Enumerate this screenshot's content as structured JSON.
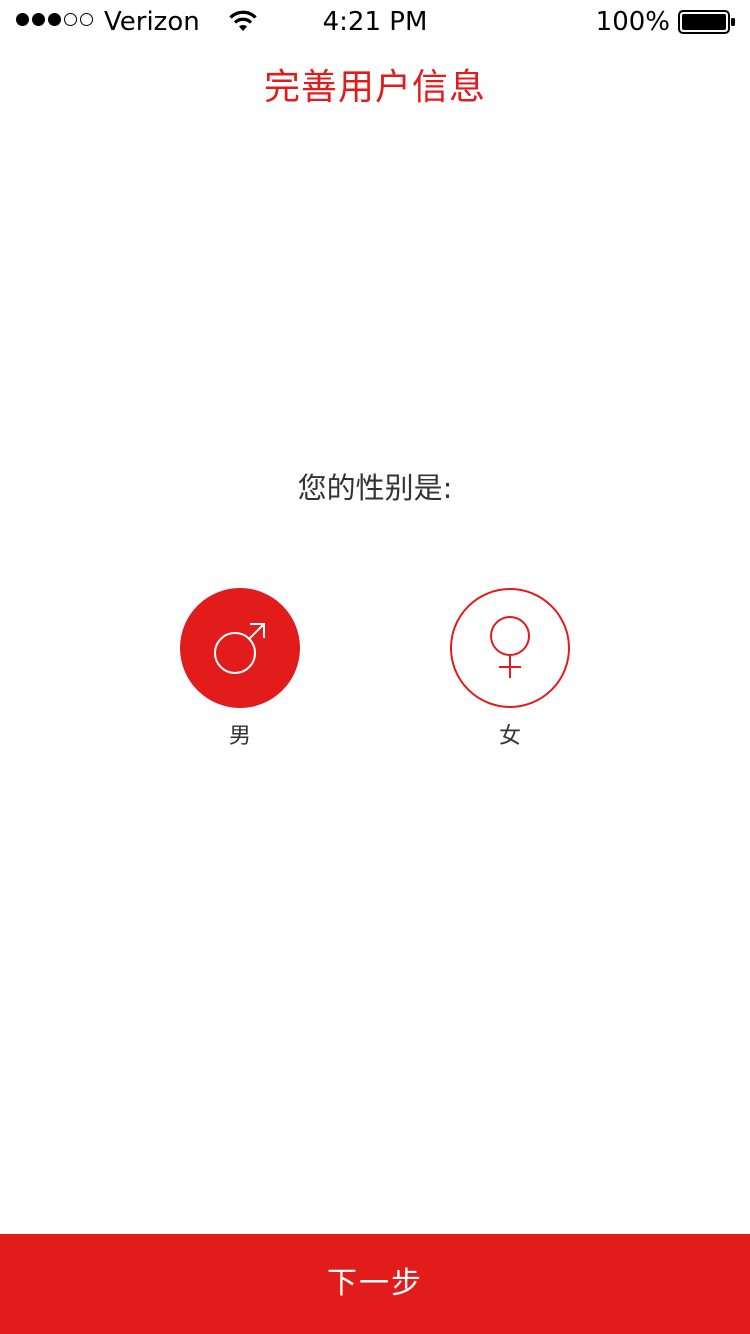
{
  "status_bar": {
    "carrier": "Verizon",
    "time": "4:21 PM",
    "battery": "100%",
    "signal_bars_filled": 3,
    "signal_bars_total": 5
  },
  "header": {
    "title": "完善用户信息"
  },
  "main": {
    "question": "您的性别是:",
    "options": [
      {
        "label": "男",
        "icon": "male-symbol-icon",
        "selected": true
      },
      {
        "label": "女",
        "icon": "female-symbol-icon",
        "selected": false
      }
    ]
  },
  "footer": {
    "next_label": "下一步"
  },
  "colors": {
    "accent": "#e21b1b",
    "text": "#333333",
    "background": "#ffffff"
  }
}
